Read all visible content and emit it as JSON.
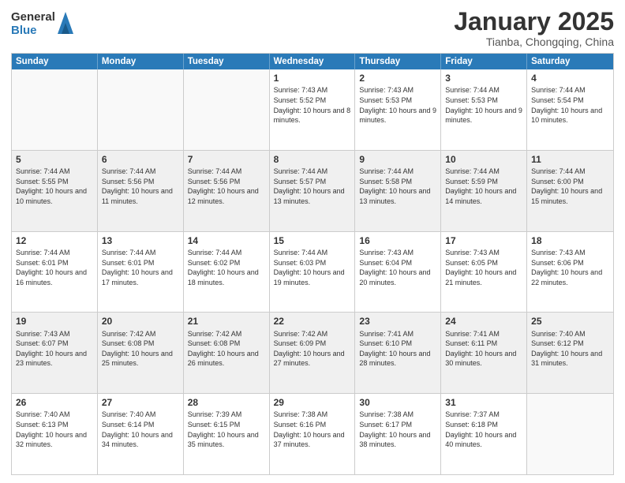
{
  "logo": {
    "general": "General",
    "blue": "Blue"
  },
  "header": {
    "month": "January 2025",
    "location": "Tianba, Chongqing, China"
  },
  "weekdays": [
    "Sunday",
    "Monday",
    "Tuesday",
    "Wednesday",
    "Thursday",
    "Friday",
    "Saturday"
  ],
  "weeks": [
    [
      {
        "day": "",
        "sunrise": "",
        "sunset": "",
        "daylight": ""
      },
      {
        "day": "",
        "sunrise": "",
        "sunset": "",
        "daylight": ""
      },
      {
        "day": "",
        "sunrise": "",
        "sunset": "",
        "daylight": ""
      },
      {
        "day": "1",
        "sunrise": "Sunrise: 7:43 AM",
        "sunset": "Sunset: 5:52 PM",
        "daylight": "Daylight: 10 hours and 8 minutes."
      },
      {
        "day": "2",
        "sunrise": "Sunrise: 7:43 AM",
        "sunset": "Sunset: 5:53 PM",
        "daylight": "Daylight: 10 hours and 9 minutes."
      },
      {
        "day": "3",
        "sunrise": "Sunrise: 7:44 AM",
        "sunset": "Sunset: 5:53 PM",
        "daylight": "Daylight: 10 hours and 9 minutes."
      },
      {
        "day": "4",
        "sunrise": "Sunrise: 7:44 AM",
        "sunset": "Sunset: 5:54 PM",
        "daylight": "Daylight: 10 hours and 10 minutes."
      }
    ],
    [
      {
        "day": "5",
        "sunrise": "Sunrise: 7:44 AM",
        "sunset": "Sunset: 5:55 PM",
        "daylight": "Daylight: 10 hours and 10 minutes."
      },
      {
        "day": "6",
        "sunrise": "Sunrise: 7:44 AM",
        "sunset": "Sunset: 5:56 PM",
        "daylight": "Daylight: 10 hours and 11 minutes."
      },
      {
        "day": "7",
        "sunrise": "Sunrise: 7:44 AM",
        "sunset": "Sunset: 5:56 PM",
        "daylight": "Daylight: 10 hours and 12 minutes."
      },
      {
        "day": "8",
        "sunrise": "Sunrise: 7:44 AM",
        "sunset": "Sunset: 5:57 PM",
        "daylight": "Daylight: 10 hours and 13 minutes."
      },
      {
        "day": "9",
        "sunrise": "Sunrise: 7:44 AM",
        "sunset": "Sunset: 5:58 PM",
        "daylight": "Daylight: 10 hours and 13 minutes."
      },
      {
        "day": "10",
        "sunrise": "Sunrise: 7:44 AM",
        "sunset": "Sunset: 5:59 PM",
        "daylight": "Daylight: 10 hours and 14 minutes."
      },
      {
        "day": "11",
        "sunrise": "Sunrise: 7:44 AM",
        "sunset": "Sunset: 6:00 PM",
        "daylight": "Daylight: 10 hours and 15 minutes."
      }
    ],
    [
      {
        "day": "12",
        "sunrise": "Sunrise: 7:44 AM",
        "sunset": "Sunset: 6:01 PM",
        "daylight": "Daylight: 10 hours and 16 minutes."
      },
      {
        "day": "13",
        "sunrise": "Sunrise: 7:44 AM",
        "sunset": "Sunset: 6:01 PM",
        "daylight": "Daylight: 10 hours and 17 minutes."
      },
      {
        "day": "14",
        "sunrise": "Sunrise: 7:44 AM",
        "sunset": "Sunset: 6:02 PM",
        "daylight": "Daylight: 10 hours and 18 minutes."
      },
      {
        "day": "15",
        "sunrise": "Sunrise: 7:44 AM",
        "sunset": "Sunset: 6:03 PM",
        "daylight": "Daylight: 10 hours and 19 minutes."
      },
      {
        "day": "16",
        "sunrise": "Sunrise: 7:43 AM",
        "sunset": "Sunset: 6:04 PM",
        "daylight": "Daylight: 10 hours and 20 minutes."
      },
      {
        "day": "17",
        "sunrise": "Sunrise: 7:43 AM",
        "sunset": "Sunset: 6:05 PM",
        "daylight": "Daylight: 10 hours and 21 minutes."
      },
      {
        "day": "18",
        "sunrise": "Sunrise: 7:43 AM",
        "sunset": "Sunset: 6:06 PM",
        "daylight": "Daylight: 10 hours and 22 minutes."
      }
    ],
    [
      {
        "day": "19",
        "sunrise": "Sunrise: 7:43 AM",
        "sunset": "Sunset: 6:07 PM",
        "daylight": "Daylight: 10 hours and 23 minutes."
      },
      {
        "day": "20",
        "sunrise": "Sunrise: 7:42 AM",
        "sunset": "Sunset: 6:08 PM",
        "daylight": "Daylight: 10 hours and 25 minutes."
      },
      {
        "day": "21",
        "sunrise": "Sunrise: 7:42 AM",
        "sunset": "Sunset: 6:08 PM",
        "daylight": "Daylight: 10 hours and 26 minutes."
      },
      {
        "day": "22",
        "sunrise": "Sunrise: 7:42 AM",
        "sunset": "Sunset: 6:09 PM",
        "daylight": "Daylight: 10 hours and 27 minutes."
      },
      {
        "day": "23",
        "sunrise": "Sunrise: 7:41 AM",
        "sunset": "Sunset: 6:10 PM",
        "daylight": "Daylight: 10 hours and 28 minutes."
      },
      {
        "day": "24",
        "sunrise": "Sunrise: 7:41 AM",
        "sunset": "Sunset: 6:11 PM",
        "daylight": "Daylight: 10 hours and 30 minutes."
      },
      {
        "day": "25",
        "sunrise": "Sunrise: 7:40 AM",
        "sunset": "Sunset: 6:12 PM",
        "daylight": "Daylight: 10 hours and 31 minutes."
      }
    ],
    [
      {
        "day": "26",
        "sunrise": "Sunrise: 7:40 AM",
        "sunset": "Sunset: 6:13 PM",
        "daylight": "Daylight: 10 hours and 32 minutes."
      },
      {
        "day": "27",
        "sunrise": "Sunrise: 7:40 AM",
        "sunset": "Sunset: 6:14 PM",
        "daylight": "Daylight: 10 hours and 34 minutes."
      },
      {
        "day": "28",
        "sunrise": "Sunrise: 7:39 AM",
        "sunset": "Sunset: 6:15 PM",
        "daylight": "Daylight: 10 hours and 35 minutes."
      },
      {
        "day": "29",
        "sunrise": "Sunrise: 7:38 AM",
        "sunset": "Sunset: 6:16 PM",
        "daylight": "Daylight: 10 hours and 37 minutes."
      },
      {
        "day": "30",
        "sunrise": "Sunrise: 7:38 AM",
        "sunset": "Sunset: 6:17 PM",
        "daylight": "Daylight: 10 hours and 38 minutes."
      },
      {
        "day": "31",
        "sunrise": "Sunrise: 7:37 AM",
        "sunset": "Sunset: 6:18 PM",
        "daylight": "Daylight: 10 hours and 40 minutes."
      },
      {
        "day": "",
        "sunrise": "",
        "sunset": "",
        "daylight": ""
      }
    ]
  ]
}
